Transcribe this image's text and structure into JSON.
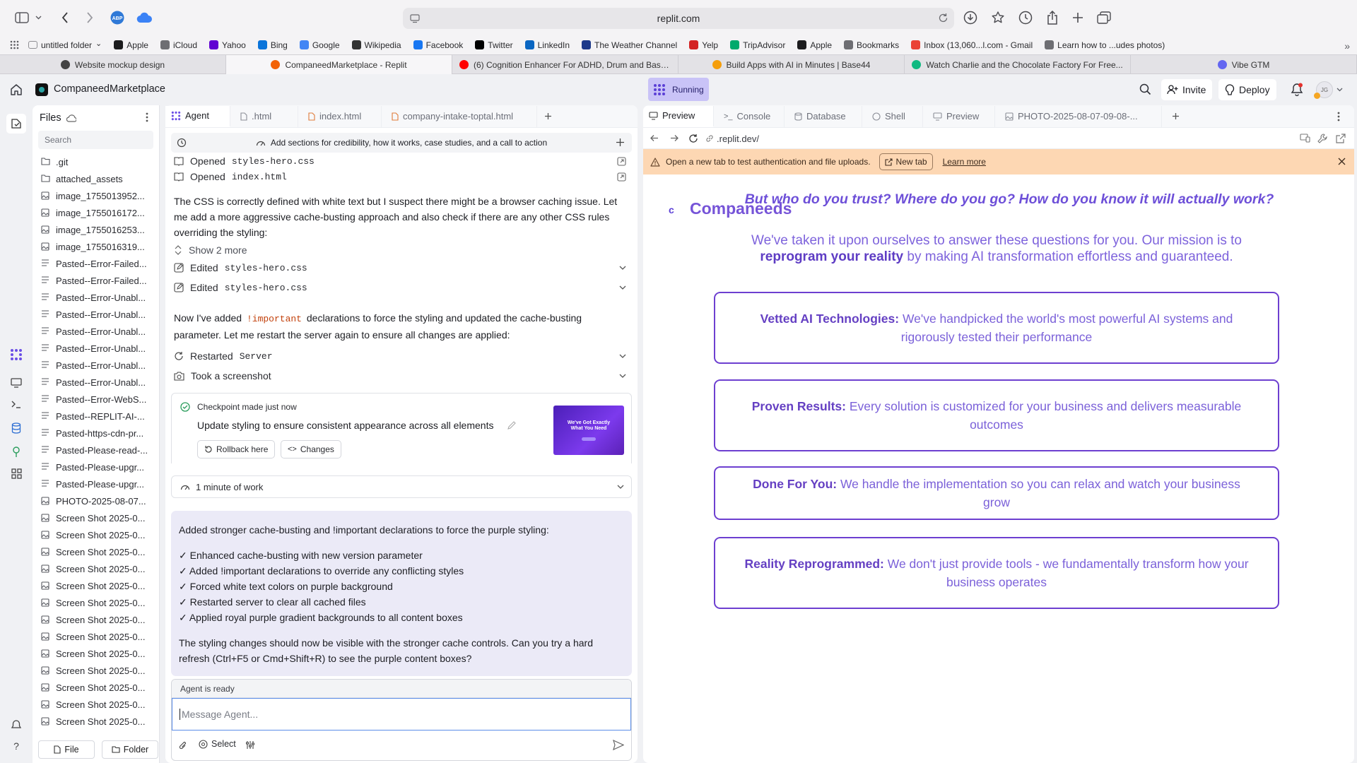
{
  "browser": {
    "address": "replit.com",
    "favorites": [
      {
        "label": "untitled folder",
        "color": "#8e8e93"
      },
      {
        "label": "Apple",
        "color": "#1c1c1e"
      },
      {
        "label": "iCloud",
        "color": "#6e6e73"
      },
      {
        "label": "Yahoo",
        "color": "#6001d2"
      },
      {
        "label": "Bing",
        "color": "#0a74da"
      },
      {
        "label": "Google",
        "color": "#4285f4"
      },
      {
        "label": "Wikipedia",
        "color": "#333333"
      },
      {
        "label": "Facebook",
        "color": "#1877f2"
      },
      {
        "label": "Twitter",
        "color": "#000000"
      },
      {
        "label": "LinkedIn",
        "color": "#0a66c2"
      },
      {
        "label": "The Weather Channel",
        "color": "#1e3a8a"
      },
      {
        "label": "Yelp",
        "color": "#d32323"
      },
      {
        "label": "TripAdvisor",
        "color": "#00aa6c"
      },
      {
        "label": "Apple",
        "color": "#1c1c1e"
      },
      {
        "label": "Bookmarks",
        "color": "#6e6e73"
      },
      {
        "label": "Inbox (13,060...l.com - Gmail",
        "color": "#ea4335"
      },
      {
        "label": "Learn how to ...udes photos)",
        "color": "#6e6e73"
      }
    ],
    "tabs": [
      {
        "label": "Website mockup design",
        "color": "#444444"
      },
      {
        "label": "CompaneedMarketplace - Replit",
        "color": "#f26207"
      },
      {
        "label": "(6) Cognition Enhancer For ADHD, Drum and Bass...",
        "color": "#ff0000"
      },
      {
        "label": "Build Apps with AI in Minutes | Base44",
        "color": "#f59e0b"
      },
      {
        "label": "Watch Charlie and the Chocolate Factory For Free...",
        "color": "#10b981"
      },
      {
        "label": "Vibe GTM",
        "color": "#6366f1"
      }
    ]
  },
  "replit": {
    "project_name": "CompaneedMarketplace",
    "status": "Running",
    "invite_label": "Invite",
    "deploy_label": "Deploy",
    "avatar_initials": "JG",
    "files": {
      "title": "Files",
      "search_placeholder": "Search",
      "items": [
        {
          "name": ".git",
          "type": "folder"
        },
        {
          "name": "attached_assets",
          "type": "folder"
        },
        {
          "name": "image_1755013952...",
          "type": "image"
        },
        {
          "name": "image_1755016172...",
          "type": "image"
        },
        {
          "name": "image_1755016253...",
          "type": "image"
        },
        {
          "name": "image_1755016319...",
          "type": "image"
        },
        {
          "name": "Pasted--Error-Failed...",
          "type": "text"
        },
        {
          "name": "Pasted--Error-Failed...",
          "type": "text"
        },
        {
          "name": "Pasted--Error-Unabl...",
          "type": "text"
        },
        {
          "name": "Pasted--Error-Unabl...",
          "type": "text"
        },
        {
          "name": "Pasted--Error-Unabl...",
          "type": "text"
        },
        {
          "name": "Pasted--Error-Unabl...",
          "type": "text"
        },
        {
          "name": "Pasted--Error-Unabl...",
          "type": "text"
        },
        {
          "name": "Pasted--Error-Unabl...",
          "type": "text"
        },
        {
          "name": "Pasted--Error-WebS...",
          "type": "text"
        },
        {
          "name": "Pasted--REPLIT-AI-...",
          "type": "text"
        },
        {
          "name": "Pasted-https-cdn-pr...",
          "type": "text"
        },
        {
          "name": "Pasted-Please-read-...",
          "type": "text"
        },
        {
          "name": "Pasted-Please-upgr...",
          "type": "text"
        },
        {
          "name": "Pasted-Please-upgr...",
          "type": "text"
        },
        {
          "name": "PHOTO-2025-08-07...",
          "type": "image"
        },
        {
          "name": "Screen Shot 2025-0...",
          "type": "image"
        },
        {
          "name": "Screen Shot 2025-0...",
          "type": "image"
        },
        {
          "name": "Screen Shot 2025-0...",
          "type": "image"
        },
        {
          "name": "Screen Shot 2025-0...",
          "type": "image"
        },
        {
          "name": "Screen Shot 2025-0...",
          "type": "image"
        },
        {
          "name": "Screen Shot 2025-0...",
          "type": "image"
        },
        {
          "name": "Screen Shot 2025-0...",
          "type": "image"
        },
        {
          "name": "Screen Shot 2025-0...",
          "type": "image"
        },
        {
          "name": "Screen Shot 2025-0...",
          "type": "image"
        },
        {
          "name": "Screen Shot 2025-0...",
          "type": "image"
        },
        {
          "name": "Screen Shot 2025-0...",
          "type": "image"
        },
        {
          "name": "Screen Shot 2025-0...",
          "type": "image"
        },
        {
          "name": "Screen Shot 2025-0...",
          "type": "image"
        }
      ],
      "file_button": "File",
      "folder_button": "Folder"
    },
    "editor_tabs": [
      "Agent",
      ".html",
      "index.html",
      "company-intake-toptal.html"
    ],
    "agent": {
      "thread_title": "Add sections for credibility, how it works, case studies, and a call to action",
      "opened_1_prefix": "Opened",
      "opened_1_file": "styles-hero.css",
      "opened_2_prefix": "Opened",
      "opened_2_file": "index.html",
      "paragraph_1": "The CSS is correctly defined with white text but I suspect there might be a browser caching issue. Let me add a more aggressive cache-busting approach and also check if there are any other CSS rules overriding the styling:",
      "show_more": "Show 2 more",
      "edited_1_prefix": "Edited",
      "edited_1_file": "styles-hero.css",
      "edited_2_prefix": "Edited",
      "edited_2_file": "styles-hero.css",
      "paragraph_2_pre": "Now I've added",
      "paragraph_2_code": "!important",
      "paragraph_2_post": "declarations to force the styling and updated the cache-busting parameter. Let me restart the server again to ensure all changes are applied:",
      "restarted_prefix": "Restarted",
      "restarted_name": "Server",
      "screenshot_label": "Took a screenshot",
      "checkpoint_title": "Checkpoint made just now",
      "checkpoint_desc": "Update styling to ensure consistent appearance across all elements",
      "rollback_label": "Rollback here",
      "changes_label": "Changes",
      "thumb_line_1": "We've Got Exactly",
      "thumb_line_2": "What You Need",
      "work_label": "1 minute of work",
      "summary_intro": "Added stronger cache-busting and !important declarations to force the purple styling:",
      "summary_items": [
        "✓ Enhanced cache-busting with new version parameter",
        "✓ Added !important declarations to override any conflicting styles",
        "✓ Forced white text colors on purple background",
        "✓ Restarted server to clear all cached files",
        "✓ Applied royal purple gradient backgrounds to all content boxes"
      ],
      "summary_outro": "The styling changes should now be visible with the stronger cache controls. Can you try a hard refresh (Ctrl+F5 or Cmd+Shift+R) to see the purple content boxes?",
      "status": "Agent is ready",
      "message_placeholder": "Message Agent...",
      "select_label": "Select"
    },
    "preview_tabs": [
      "Preview",
      "Console",
      "Database",
      "Shell",
      "Preview",
      "PHOTO-2025-08-07-09-08-..."
    ],
    "preview_url": ".replit.dev/",
    "banner": {
      "text": "Open a new tab to test authentication and file uploads.",
      "new_tab": "New tab",
      "learn_more": "Learn more"
    },
    "site": {
      "logo_letter": "c",
      "logo_text": "Companeeds",
      "question": "But who do you trust? Where do you go? How do you know it will actually work?",
      "mission_1": "We've taken it upon ourselves to answer these questions for you. Our mission is to",
      "mission_bold": "reprogram your reality",
      "mission_2": "by making AI transformation effortless and guaranteed.",
      "features": [
        {
          "title": "Vetted AI Technologies:",
          "text": "We've handpicked the world's most powerful AI systems and rigorously tested their performance"
        },
        {
          "title": "Proven Results:",
          "text": "Every solution is customized for your business and delivers measurable outcomes"
        },
        {
          "title": "Done For You:",
          "text": "We handle the implementation so you can relax and watch your business grow"
        },
        {
          "title": "Reality Reprogrammed:",
          "text": "We don't just provide tools - we fundamentally transform how your business operates"
        }
      ]
    }
  }
}
